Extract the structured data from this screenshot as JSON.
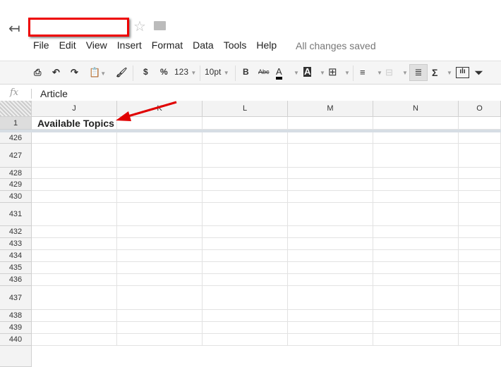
{
  "header": {
    "back_icon": "back-arrow-icon",
    "title": "",
    "menu": [
      "File",
      "Edit",
      "View",
      "Insert",
      "Format",
      "Data",
      "Tools",
      "Help"
    ],
    "status": "All changes saved"
  },
  "toolbar": {
    "currency": "$",
    "percent": "%",
    "number_format": "123",
    "font_size": "10pt",
    "bold": "B",
    "strikethrough": "Abc",
    "text_color": "A",
    "fill_color": "A",
    "functions": "Σ"
  },
  "formula_bar": {
    "fx_label": "fx",
    "value": "Article"
  },
  "columns": [
    "J",
    "K",
    "L",
    "M",
    "N",
    "O"
  ],
  "rows": [
    {
      "num": "1",
      "J": "Available Topics"
    },
    {
      "num": "426"
    },
    {
      "num": "427"
    },
    {
      "num": "428"
    },
    {
      "num": "429"
    },
    {
      "num": "430"
    },
    {
      "num": "431"
    },
    {
      "num": "432"
    },
    {
      "num": "433"
    },
    {
      "num": "434"
    },
    {
      "num": "435"
    },
    {
      "num": "436"
    },
    {
      "num": "437"
    },
    {
      "num": "438"
    },
    {
      "num": "439"
    },
    {
      "num": "440"
    }
  ],
  "annotation_color": "#e00000"
}
